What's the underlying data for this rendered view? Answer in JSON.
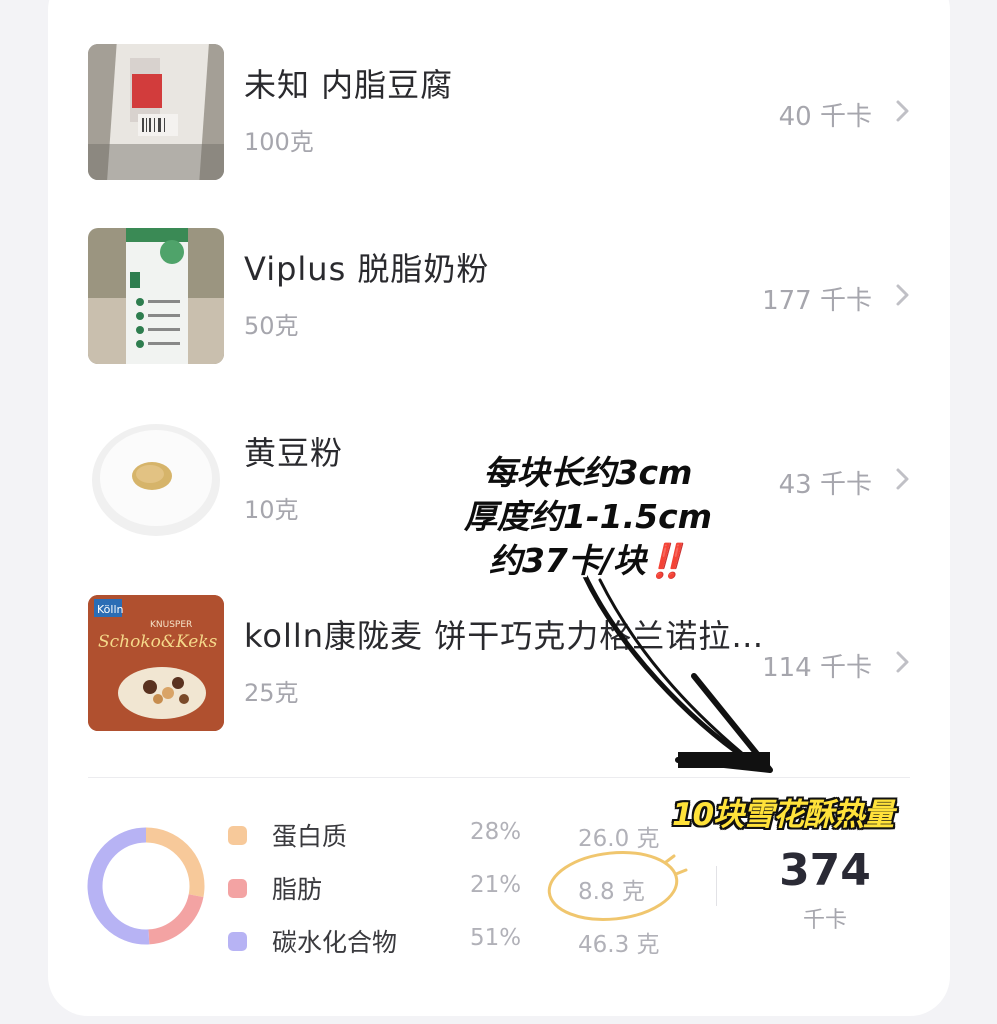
{
  "foods": [
    {
      "name": "未知 内脂豆腐",
      "qty": "100克",
      "kcal": "40 千卡",
      "image": "tofu-package"
    },
    {
      "name": "Viplus 脱脂奶粉",
      "qty": "50克",
      "kcal": "177 千卡",
      "image": "milk-powder-package"
    },
    {
      "name": "黄豆粉",
      "qty": "10克",
      "kcal": "43 千卡",
      "image": "soybean-powder-plate"
    },
    {
      "name": "kolln康陇麦 饼干巧克力格兰诺拉…",
      "qty": "25克",
      "kcal": "114 千卡",
      "image": "granola-box",
      "box_brand": "Kölln",
      "box_text_1": "KNUSPER",
      "box_text_2": "Schoko&Keks"
    }
  ],
  "nutrition": {
    "items": [
      {
        "name": "蛋白质",
        "pct": "28%",
        "grams": "26.0 克",
        "color": "#f7c99a",
        "fraction": 0.28
      },
      {
        "name": "脂肪",
        "pct": "21%",
        "grams": "8.8 克",
        "color": "#f3a3a3",
        "fraction": 0.21
      },
      {
        "name": "碳水化合物",
        "pct": "51%",
        "grams": "46.3 克",
        "color": "#b7b3f4",
        "fraction": 0.51
      }
    ],
    "total": "374",
    "total_unit": "千卡"
  },
  "annotations": {
    "note_line1": "每块长约3cm",
    "note_line2": "厚度约1-1.5cm",
    "note_line3": "约37卡/块",
    "note_excl": "‼️",
    "caption": "10块雪花酥热量",
    "circle_color": "#f0c66e"
  }
}
